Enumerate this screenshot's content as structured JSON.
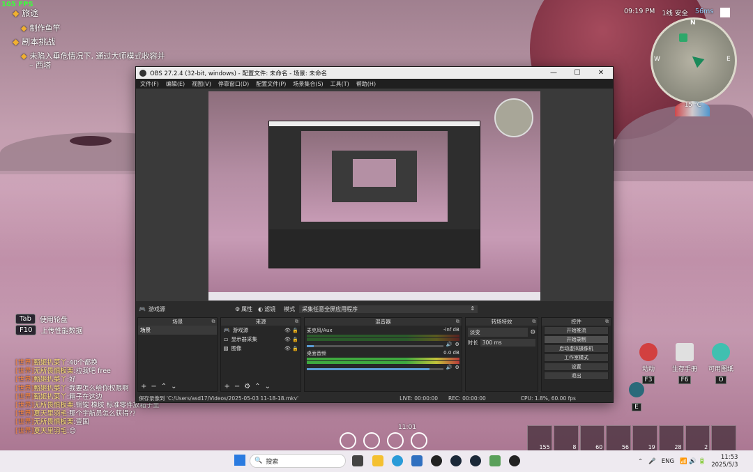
{
  "game": {
    "fps": "105 FPS",
    "quests": [
      {
        "title": "旅途",
        "items": [
          "制作鱼竿"
        ]
      },
      {
        "title": "剧本挑战",
        "items": [
          "未陷入垂危情况下, 通过大师模式收容并",
          "– 西塔"
        ]
      }
    ],
    "hints": [
      {
        "key": "Tab",
        "label": "使用轮盘"
      },
      {
        "key": "F10",
        "label": "上传性能数据"
      }
    ],
    "status": {
      "time": "09:19 PM",
      "server": "1线 安全",
      "ping": "56ms"
    },
    "compass": {
      "north": "N",
      "east": "E",
      "west": "W",
      "temp": "15 °C"
    },
    "chat": [
      {
        "ch": "[世界]",
        "name": "甄姬扒菜丫",
        "msg": ":40个都换"
      },
      {
        "ch": "[世界]",
        "name": "无所畏惧板栗",
        "msg": ":拉我吧 free"
      },
      {
        "ch": "[世界]",
        "name": "甄姬扒菜丫",
        "msg": ":好"
      },
      {
        "ch": "[世界]",
        "name": "甄姬扒菜丫",
        "msg": ":我要怎么给你权限啊"
      },
      {
        "ch": "[世界]",
        "name": "甄姬扒菜丫",
        "msg": ":箱子在这边"
      },
      {
        "ch": "[世界]",
        "name": "无所畏惧板栗",
        "msg": ":铜锭 橡胶 标准零件放箱子里"
      },
      {
        "ch": "[世界]",
        "name": "夏天里羽毛",
        "msg": ":那个宇航员怎么获得??"
      },
      {
        "ch": "[世界]",
        "name": "无所畏惧板栗",
        "msg": ":壹国"
      },
      {
        "ch": "[世界]",
        "name": "夏天里羽毛",
        "msg": ":😊"
      }
    ],
    "abilities": [
      {
        "label": "动动",
        "key": "F3",
        "color": "#d24040"
      },
      {
        "label": "生存手册",
        "key": "F6",
        "color": "#e0e0e0"
      },
      {
        "label": "可用图纸",
        "key": "O",
        "color": "#40c0b0"
      }
    ],
    "extra_key": "E",
    "center_time": "11:01",
    "hotbar": [
      "155",
      "8",
      "60",
      "56",
      "19",
      "28",
      "2",
      ""
    ]
  },
  "obs": {
    "title": "OBS 27.2.4 (32-bit, windows) - 配置文件: 未命名 - 场景: 未命名",
    "window_controls": [
      "—",
      "☐",
      "✕"
    ],
    "menu": [
      "文件(F)",
      "编辑(E)",
      "视图(V)",
      "停靠窗口(D)",
      "配置文件(P)",
      "场景集合(S)",
      "工具(T)",
      "帮助(H)"
    ],
    "source_bar": {
      "source_name": "游戏源",
      "props": "属性",
      "filters": "滤镜",
      "mode_label": "模式",
      "mode_value": "采集任意全屏应用程序"
    },
    "docks": {
      "scenes": {
        "title": "场景",
        "items": [
          "场景"
        ]
      },
      "sources": {
        "title": "来源",
        "items": [
          "游戏源",
          "显示器采集",
          "图像"
        ]
      },
      "mixer": {
        "title": "混音器",
        "channels": [
          {
            "name": "麦克风/Aux",
            "level": "-inf dB",
            "volume": 0.05
          },
          {
            "name": "桌面音频",
            "level": "0.0 dB",
            "volume": 0.9
          }
        ]
      },
      "transitions": {
        "title": "转场特效",
        "type": "淡变",
        "duration_label": "时长",
        "duration": "300 ms"
      },
      "controls": {
        "title": "控件",
        "buttons": [
          "开始推流",
          "开始录制",
          "启动虚拟摄像机",
          "工作室模式",
          "设置",
          "退出"
        ],
        "active_index": 1
      }
    },
    "status": {
      "saved": "保存录像到 'C:/Users/asd17/Videos/2025-05-03 11-18-18.mkv'",
      "live": "LIVE: 00:00:00",
      "rec": "REC: 00:00:00",
      "cpu": "CPU: 1.8%, 60.00 fps"
    }
  },
  "taskbar": {
    "search_placeholder": "搜索",
    "lang": "ENG",
    "time": "11:53",
    "date": "2025/5/3"
  }
}
